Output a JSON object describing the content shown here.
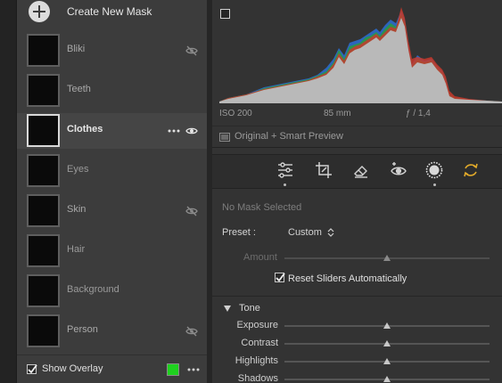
{
  "masks_panel": {
    "create_label": "Create New Mask",
    "masks": [
      {
        "label": "Bliki",
        "visibility_icon": "eye-slash-icon",
        "state": "normal"
      },
      {
        "label": "Teeth",
        "visibility_icon": "",
        "state": "normal"
      },
      {
        "label": "Clothes",
        "visibility_icon": "eye-icon",
        "state": "selected"
      },
      {
        "label": "Eyes",
        "visibility_icon": "",
        "state": "normal"
      },
      {
        "label": "Skin",
        "visibility_icon": "eye-slash-icon",
        "state": "normal"
      },
      {
        "label": "Hair",
        "visibility_icon": "",
        "state": "normal"
      },
      {
        "label": "Background",
        "visibility_icon": "",
        "state": "normal"
      },
      {
        "label": "Person",
        "visibility_icon": "eye-slash-icon",
        "state": "normal"
      }
    ],
    "show_overlay_label": "Show Overlay",
    "show_overlay_checked": true,
    "overlay_color": "#1fd11f"
  },
  "histogram": {
    "iso": "ISO 200",
    "focal_length": "85 mm",
    "aperture": "ƒ / 1,4",
    "preview_label": "Original + Smart Preview"
  },
  "toolbar": {
    "tools": [
      "sliders-icon",
      "crop-icon",
      "eraser-icon",
      "redeye-icon",
      "masking-icon",
      "reset-icon"
    ],
    "active_tool": "masking-icon"
  },
  "mask_settings": {
    "no_mask_label": "No Mask Selected",
    "preset_label": "Preset :",
    "preset_value": "Custom",
    "amount_label": "Amount",
    "amount_value": 0.5,
    "reset_sliders_label": "Reset Sliders Automatically",
    "reset_sliders_checked": true
  },
  "tone": {
    "title": "Tone",
    "sliders": [
      {
        "label": "Exposure",
        "value": 0.5
      },
      {
        "label": "Contrast",
        "value": 0.5
      },
      {
        "label": "Highlights",
        "value": 0.5
      },
      {
        "label": "Shadows",
        "value": 0.5
      }
    ]
  }
}
